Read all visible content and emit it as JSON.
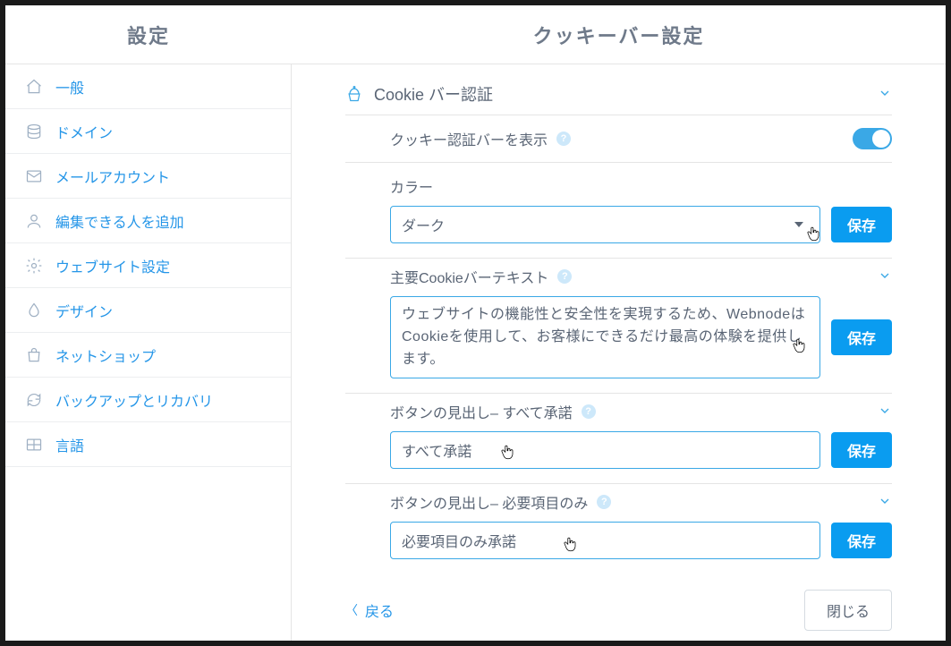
{
  "sidebar_title": "設定",
  "page_title": "クッキーバー設定",
  "sidebar": {
    "items": [
      {
        "label": "一般"
      },
      {
        "label": "ドメイン"
      },
      {
        "label": "メールアカウント"
      },
      {
        "label": "編集できる人を追加"
      },
      {
        "label": "ウェブサイト設定"
      },
      {
        "label": "デザイン"
      },
      {
        "label": "ネットショップ"
      },
      {
        "label": "バックアップとリカバリ"
      },
      {
        "label": "言語"
      }
    ]
  },
  "section": {
    "title": "Cookie バー認証"
  },
  "toggle_row": {
    "label": "クッキー認証バーを表示",
    "on": true
  },
  "color_field": {
    "label": "カラー",
    "value": "ダーク",
    "save": "保存"
  },
  "main_text_field": {
    "label": "主要Cookieバーテキスト",
    "value": "ウェブサイトの機能性と安全性を実現するため、WebnodeはCookieを使用して、お客様にできるだけ最高の体験を提供します。",
    "save": "保存"
  },
  "btn_accept_all": {
    "label": "ボタンの見出し– すべて承諾",
    "value": "すべて承諾",
    "save": "保存"
  },
  "btn_essential": {
    "label": "ボタンの見出し– 必要項目のみ",
    "value": "必要項目のみ承諾",
    "save": "保存"
  },
  "footer": {
    "back": "戻る",
    "close": "閉じる"
  }
}
